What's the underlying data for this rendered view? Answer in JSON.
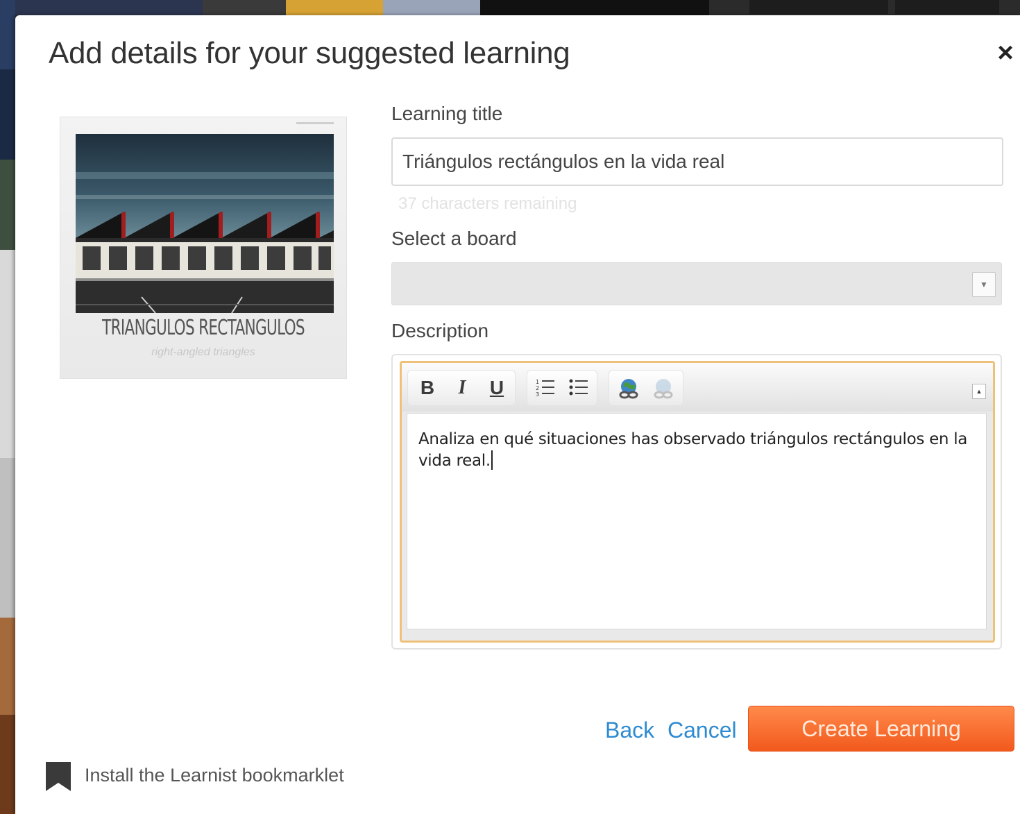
{
  "modal": {
    "title": "Add details for your suggested learning",
    "close_label": "×"
  },
  "thumbnail": {
    "caption": "TRIANGULOS RECTANGULOS",
    "subcaption": "right-angled triangles"
  },
  "form": {
    "learning_title_label": "Learning title",
    "learning_title_value": "Triángulos rectángulos en la vida real",
    "chars_remaining": "37 characters remaining",
    "board_label": "Select a board",
    "board_value": "",
    "description_label": "Description",
    "description_value": "Analiza en qué situaciones has observado triángulos rectángulos en la vida real."
  },
  "toolbar": {
    "bold": "B",
    "italic": "I",
    "underline": "U",
    "icons": [
      "ordered-list-icon",
      "unordered-list-icon",
      "link-icon",
      "unlink-icon"
    ]
  },
  "actions": {
    "back": "Back",
    "cancel": "Cancel",
    "create": "Create Learning"
  },
  "footer": {
    "bookmarklet": "Install the Learnist bookmarklet"
  },
  "colors": {
    "accent_orange": "#f2591d",
    "link_blue": "#2e8bd1",
    "editor_focus": "#efc178"
  }
}
